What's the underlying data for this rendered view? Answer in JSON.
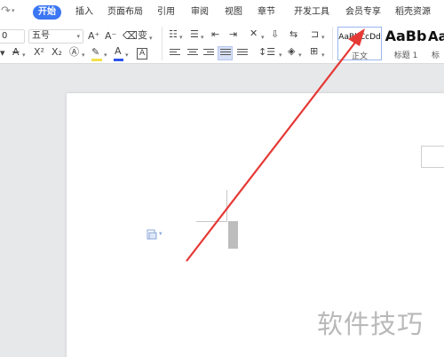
{
  "ribbon": {
    "tabs": [
      {
        "label": "开始",
        "active": true
      },
      {
        "label": "插入"
      },
      {
        "label": "页面布局"
      },
      {
        "label": "引用"
      },
      {
        "label": "审阅"
      },
      {
        "label": "视图"
      },
      {
        "label": "章节"
      },
      {
        "label": "开发工具"
      },
      {
        "label": "会员专享"
      },
      {
        "label": "稻壳资源"
      }
    ],
    "accent_color": "#3b76f3"
  },
  "toolbar": {
    "font_name_value": "0",
    "font_size_value": "五号",
    "grow_font": "A⁺",
    "shrink_font": "A⁻",
    "pinyin_label": "变",
    "strikethrough_label": "A",
    "superscript_label": "X²",
    "subscript_label": "X₂",
    "font_color_label": "A",
    "char_border_label": "A"
  },
  "styles": [
    {
      "preview": "AaBbCcDd",
      "caption": "正文",
      "selected": true
    },
    {
      "preview": "AaBb",
      "caption": "标题 1"
    },
    {
      "preview": "Aa",
      "caption": "标"
    }
  ],
  "document": {
    "watermark": "软件技巧"
  },
  "annotation": {
    "arrow_color": "#e53935"
  }
}
